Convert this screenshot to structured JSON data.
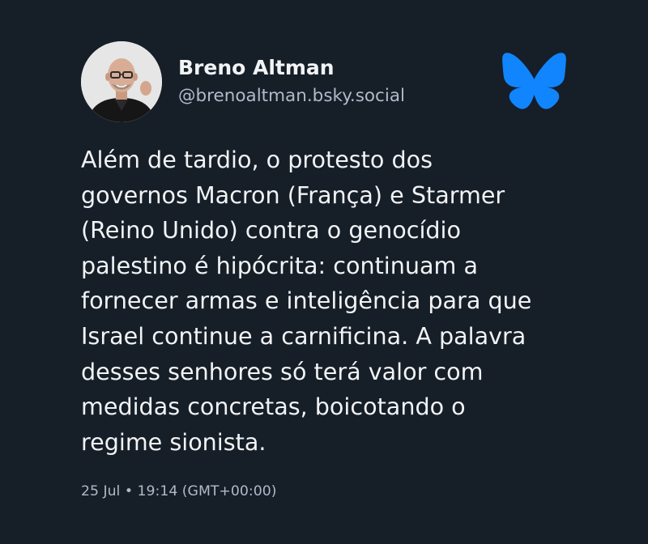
{
  "post": {
    "author": {
      "display_name": "Breno Altman",
      "handle": "@brenoaltman.bsky.social",
      "avatar_icon": "profile-photo"
    },
    "text_lines": [
      "Além de tardio, o protesto dos",
      "governos Macron (França) e Starmer",
      "(Reino Unido) contra o genocídio",
      "palestino é hipócrita: continuam a",
      "fornecer armas e inteligência para que",
      "Israel continue a carnificina. A palavra",
      "desses senhores só terá valor com",
      "medidas concretas, boicotando o",
      "regime sionista."
    ],
    "timestamp": "25 Jul • 19:14 (GMT+00:00)"
  },
  "logo": {
    "icon": "bluesky-butterfly-icon",
    "color": "#1185fe"
  },
  "colors": {
    "background": "#161e27",
    "text_primary": "#f1f3f5",
    "text_secondary": "#aebbc9"
  }
}
